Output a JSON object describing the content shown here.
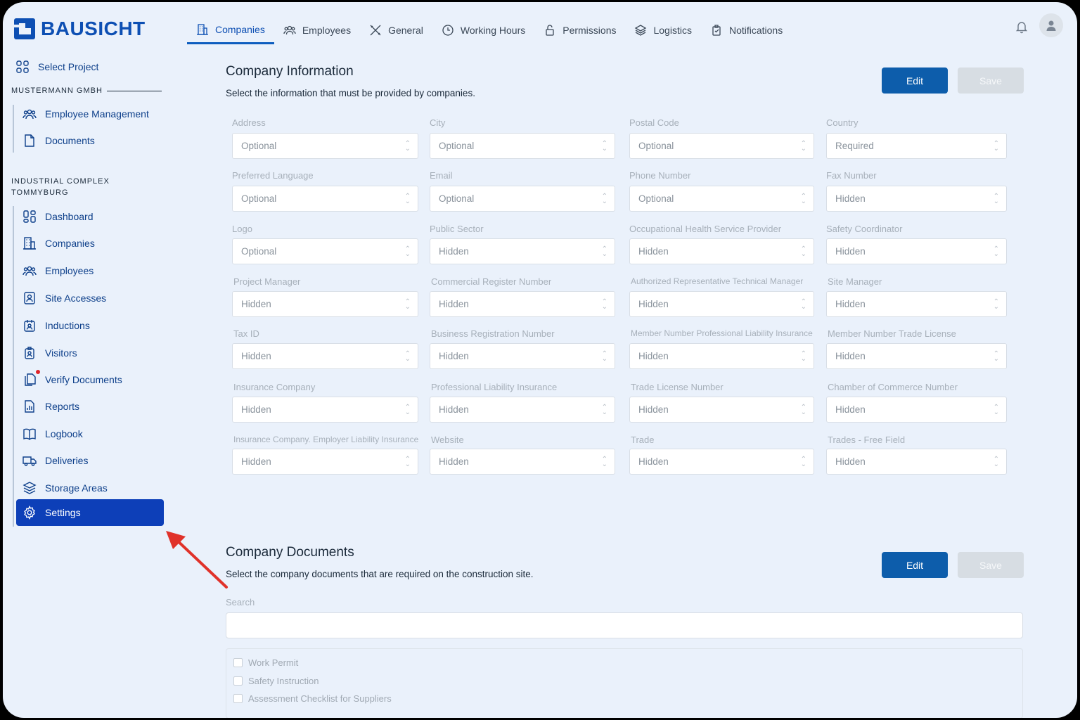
{
  "brand": {
    "name": "BAUSICHT",
    "color": "#0d4fb3"
  },
  "topnav": [
    {
      "label": "Companies",
      "icon": "building-icon",
      "active": true
    },
    {
      "label": "Employees",
      "icon": "people-icon"
    },
    {
      "label": "General",
      "icon": "tools-icon"
    },
    {
      "label": "Working Hours",
      "icon": "clock-icon"
    },
    {
      "label": "Permissions",
      "icon": "lock-icon"
    },
    {
      "label": "Logistics",
      "icon": "layers-icon"
    },
    {
      "label": "Notifications",
      "icon": "clipboard-icon"
    }
  ],
  "sidebar": {
    "select_project": "Select Project",
    "org_section": "MUSTERMANN GMBH",
    "org_items": [
      "Employee Management",
      "Documents"
    ],
    "project_section_line1": "INDUSTRIAL COMPLEX",
    "project_section_line2": "TOMMYBURG",
    "project_items": [
      "Dashboard",
      "Companies",
      "Employees",
      "Site Accesses",
      "Inductions",
      "Visitors",
      "Verify Documents",
      "Reports",
      "Logbook",
      "Deliveries",
      "Storage Areas",
      "Settings"
    ],
    "active_item": "Settings",
    "accent": "#0d3fb8"
  },
  "company_info": {
    "title": "Company Information",
    "subtitle": "Select the information that must be provided by companies.",
    "edit_label": "Edit",
    "save_label": "Save",
    "fields": [
      {
        "label": "Address",
        "value": "Optional"
      },
      {
        "label": "City",
        "value": "Optional"
      },
      {
        "label": "Postal Code",
        "value": "Optional"
      },
      {
        "label": "Country",
        "value": "Required"
      },
      {
        "label": "Preferred Language",
        "value": "Optional"
      },
      {
        "label": "Email",
        "value": "Optional"
      },
      {
        "label": "Phone Number",
        "value": "Optional"
      },
      {
        "label": "Fax Number",
        "value": "Hidden"
      },
      {
        "label": "Logo",
        "value": "Optional"
      },
      {
        "label": "Public Sector",
        "value": "Hidden"
      },
      {
        "label": "Occupational Health Service Provider",
        "value": "Hidden"
      },
      {
        "label": "Safety Coordinator",
        "value": "Hidden"
      },
      {
        "label": "Project Manager",
        "value": "Hidden"
      },
      {
        "label": "Commercial Register Number",
        "value": "Hidden"
      },
      {
        "label": "Authorized Representative Technical Manager",
        "value": "Hidden"
      },
      {
        "label": "Site Manager",
        "value": "Hidden"
      },
      {
        "label": "Tax ID",
        "value": "Hidden"
      },
      {
        "label": "Business Registration Number",
        "value": "Hidden"
      },
      {
        "label": "Member Number Professional Liability Insurance",
        "value": "Hidden"
      },
      {
        "label": "Member Number Trade License",
        "value": "Hidden"
      },
      {
        "label": "Insurance Company",
        "value": "Hidden"
      },
      {
        "label": "Professional Liability Insurance",
        "value": "Hidden"
      },
      {
        "label": "Trade License Number",
        "value": "Hidden"
      },
      {
        "label": "Chamber of Commerce Number",
        "value": "Hidden"
      },
      {
        "label": "Insurance Company. Employer Liability Insurance",
        "value": "Hidden"
      },
      {
        "label": "Website",
        "value": "Hidden"
      },
      {
        "label": "Trade",
        "value": "Hidden"
      },
      {
        "label": "Trades - Free Field",
        "value": "Hidden"
      }
    ]
  },
  "company_docs": {
    "title": "Company Documents",
    "subtitle": "Select the company documents that are required on the construction site.",
    "edit_label": "Edit",
    "save_label": "Save",
    "search_label": "Search",
    "search_value": "",
    "documents": [
      "Work Permit",
      "Safety Instruction",
      "Assessment Checklist for Suppliers"
    ]
  },
  "annotation_color": "#e0322a"
}
